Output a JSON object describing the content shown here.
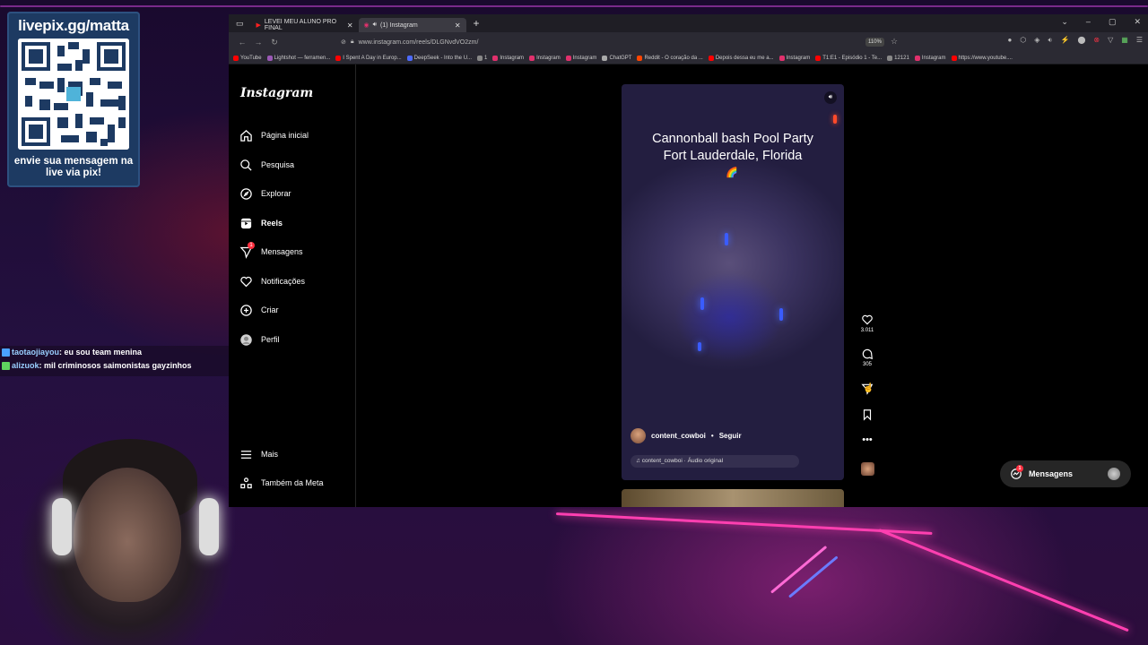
{
  "overlay": {
    "qr_title": "livepix.gg/matta",
    "qr_caption_line1": "envie sua mensagem na",
    "qr_caption_line2": "live via pix!"
  },
  "chat": [
    {
      "user": "taotaojiayou",
      "message": ": eu sou team menina",
      "badge_color": "#4aa3ff"
    },
    {
      "user": "alizuok",
      "message": ": mil criminosos saimonistas gayzinhos",
      "badge_color": "#5fd35f"
    }
  ],
  "browser": {
    "tabs": [
      {
        "label": "LEVEI MEU ALUNO PRO FINAL",
        "icon": "youtube-icon",
        "active": false
      },
      {
        "label": "(1) Instagram",
        "icon": "instagram-icon",
        "active": true
      }
    ],
    "url": "www.instagram.com/reels/DLGNvdVO2zm/",
    "zoom": "110%",
    "bookmarks": [
      {
        "label": "YouTube",
        "color": "#ff0000"
      },
      {
        "label": "Lightshot — ferramen...",
        "color": "#9b59b6"
      },
      {
        "label": "I Spent A Day in Europ...",
        "color": "#ff0000"
      },
      {
        "label": "DeepSeek - Into the U...",
        "color": "#4d6bfe"
      },
      {
        "label": "1",
        "color": "#888888"
      },
      {
        "label": "Instagram",
        "color": "#e1306c"
      },
      {
        "label": "Instagram",
        "color": "#e1306c"
      },
      {
        "label": "Instagram",
        "color": "#e1306c"
      },
      {
        "label": "ChatGPT",
        "color": "#aaaaaa"
      },
      {
        "label": "Reddit - O coração da ...",
        "color": "#ff4500"
      },
      {
        "label": "Depois dessa eu me a...",
        "color": "#ff0000"
      },
      {
        "label": "Instagram",
        "color": "#e1306c"
      },
      {
        "label": "T1:E1 - Episódio 1 - Te...",
        "color": "#ff0000"
      },
      {
        "label": "12121",
        "color": "#888888"
      },
      {
        "label": "Instagram",
        "color": "#e1306c"
      },
      {
        "label": "https://www.youtube....",
        "color": "#ff0000"
      }
    ]
  },
  "instagram": {
    "logo": "Instagram",
    "nav": {
      "home": "Página inicial",
      "search": "Pesquisa",
      "explore": "Explorar",
      "reels": "Reels",
      "messages": "Mensagens",
      "messages_badge": "1",
      "notifications": "Notificações",
      "create": "Criar",
      "profile": "Perfil",
      "more": "Mais",
      "meta": "Também da Meta"
    },
    "reel": {
      "caption_line1": "Cannonball bash Pool Party",
      "caption_line2": "Fort Lauderdale, Florida",
      "username": "content_cowboi",
      "separator": "•",
      "follow": "Seguir",
      "audio": "content_cowboi · Áudio original"
    },
    "actions": {
      "likes": "3.011",
      "comments": "305"
    },
    "messages_button": {
      "label": "Mensagens",
      "badge": "1"
    }
  }
}
